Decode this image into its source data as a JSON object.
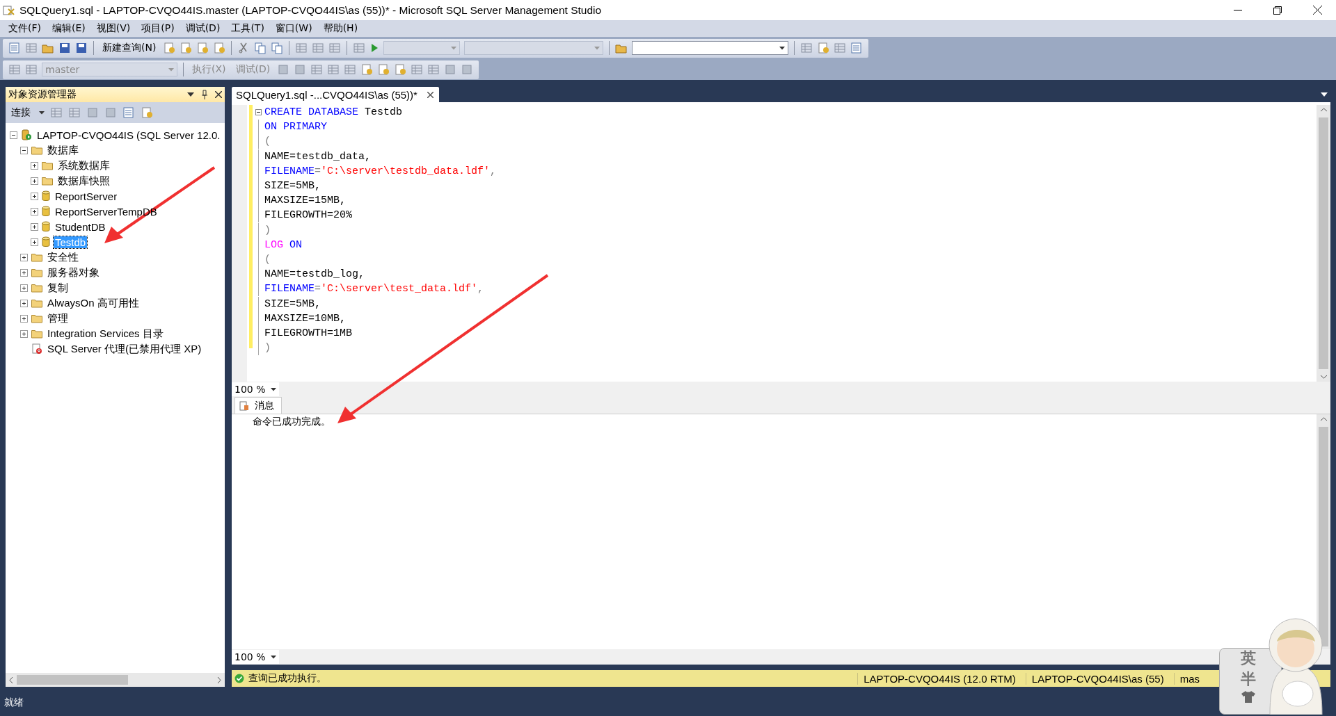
{
  "window": {
    "title": "SQLQuery1.sql - LAPTOP-CVQO44IS.master (LAPTOP-CVQO44IS\\as (55))* - Microsoft SQL Server Management Studio"
  },
  "menu": [
    "文件(F)",
    "编辑(E)",
    "视图(V)",
    "项目(P)",
    "调试(D)",
    "工具(T)",
    "窗口(W)",
    "帮助(H)"
  ],
  "toolbar": {
    "new_query": "新建查询(N)"
  },
  "query_toolbar": {
    "database": "master",
    "execute": "执行(X)",
    "debug": "调试(D)",
    "disabled": true
  },
  "object_explorer": {
    "title": "对象资源管理器",
    "connect": "连接",
    "tree": [
      {
        "kind": "server",
        "label": "LAPTOP-CVQO44IS (SQL Server 12.0.",
        "expanded": true,
        "selected": false,
        "children": [
          {
            "kind": "folder",
            "label": "数据库",
            "expanded": true,
            "selected": false,
            "children": [
              {
                "kind": "folder",
                "label": "系统数据库",
                "expanded": false,
                "selected": false
              },
              {
                "kind": "folder",
                "label": "数据库快照",
                "expanded": false,
                "selected": false
              },
              {
                "kind": "database",
                "label": "ReportServer",
                "expanded": false,
                "selected": false
              },
              {
                "kind": "database",
                "label": "ReportServerTempDB",
                "expanded": false,
                "selected": false
              },
              {
                "kind": "database",
                "label": "StudentDB",
                "expanded": false,
                "selected": false
              },
              {
                "kind": "database",
                "label": "Testdb",
                "expanded": false,
                "selected": true
              }
            ]
          },
          {
            "kind": "folder",
            "label": "安全性",
            "expanded": false,
            "selected": false
          },
          {
            "kind": "folder",
            "label": "服务器对象",
            "expanded": false,
            "selected": false
          },
          {
            "kind": "folder",
            "label": "复制",
            "expanded": false,
            "selected": false
          },
          {
            "kind": "folder",
            "label": "AlwaysOn 高可用性",
            "expanded": false,
            "selected": false
          },
          {
            "kind": "folder",
            "label": "管理",
            "expanded": false,
            "selected": false
          },
          {
            "kind": "folder",
            "label": "Integration Services 目录",
            "expanded": false,
            "selected": false
          },
          {
            "kind": "agent",
            "label": "SQL Server 代理(已禁用代理 XP)",
            "selected": false
          }
        ]
      }
    ]
  },
  "editor_tab": {
    "label": "SQLQuery1.sql -...CVQO44IS\\as (55))*",
    "selected": true
  },
  "code": [
    [
      {
        "kind": "keyword",
        "text": "CREATE DATABASE"
      },
      {
        "kind": "plain",
        "text": " Testdb"
      }
    ],
    [
      {
        "kind": "keyword",
        "text": "ON PRIMARY"
      }
    ],
    [
      {
        "kind": "punct",
        "text": "("
      }
    ],
    [
      {
        "kind": "plain",
        "text": "NAME=testdb_data,"
      }
    ],
    [
      {
        "kind": "keyword",
        "text": "FILENAME"
      },
      {
        "kind": "punct",
        "text": "="
      },
      {
        "kind": "string",
        "text": "'C:\\server\\testdb_data.ldf'"
      },
      {
        "kind": "punct",
        "text": ","
      }
    ],
    [
      {
        "kind": "plain",
        "text": "SIZE=5MB,"
      }
    ],
    [
      {
        "kind": "plain",
        "text": "MAXSIZE=15MB,"
      }
    ],
    [
      {
        "kind": "plain",
        "text": "FILEGROWTH=20%"
      }
    ],
    [
      {
        "kind": "punct",
        "text": ")"
      }
    ],
    [
      {
        "kind": "function",
        "text": "LOG"
      },
      {
        "kind": "keyword",
        "text": " ON"
      }
    ],
    [
      {
        "kind": "punct",
        "text": "("
      }
    ],
    [
      {
        "kind": "plain",
        "text": "NAME=testdb_log,"
      }
    ],
    [
      {
        "kind": "keyword",
        "text": "FILENAME"
      },
      {
        "kind": "punct",
        "text": "="
      },
      {
        "kind": "string",
        "text": "'C:\\server\\test_data.ldf'"
      },
      {
        "kind": "punct",
        "text": ","
      }
    ],
    [
      {
        "kind": "plain",
        "text": "SIZE=5MB,"
      }
    ],
    [
      {
        "kind": "plain",
        "text": "MAXSIZE=10MB,"
      }
    ],
    [
      {
        "kind": "plain",
        "text": "FILEGROWTH=1MB"
      }
    ],
    [
      {
        "kind": "punct",
        "text": ")"
      }
    ]
  ],
  "editor_zoom": "100 %",
  "results": {
    "tab": "消息",
    "message": "命令已成功完成。",
    "zoom": "100 %"
  },
  "status": {
    "message": "查询已成功执行。",
    "server": "LAPTOP-CVQO44IS (12.0 RTM)",
    "user": "LAPTOP-CVQO44IS\\as (55)",
    "database": "mas"
  },
  "bottom_status": "就绪",
  "ime": [
    "英",
    "半"
  ]
}
